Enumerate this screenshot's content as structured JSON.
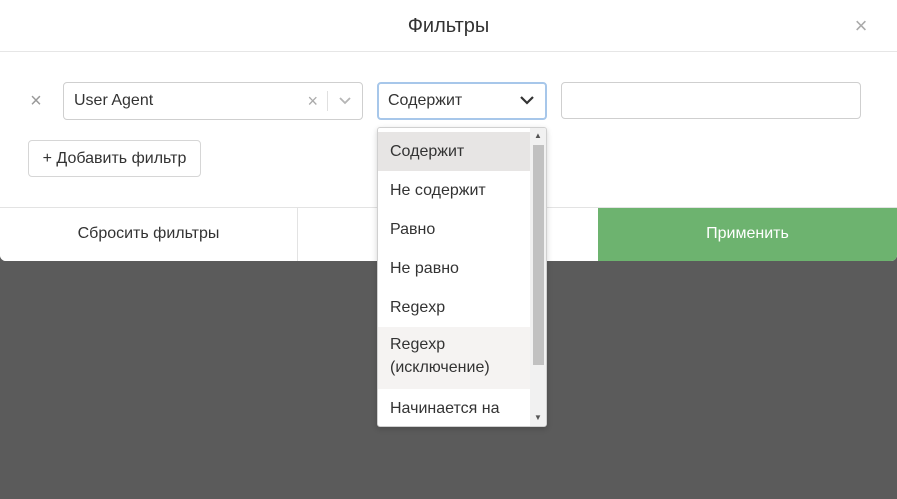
{
  "modal": {
    "title": "Фильтры",
    "close_glyph": "×"
  },
  "filter_row": {
    "remove_glyph": "×",
    "field": {
      "value": "User Agent",
      "clear_glyph": "×"
    },
    "operator": {
      "value": "Содержит",
      "expanded": true
    },
    "value_input": {
      "value": "",
      "placeholder": ""
    }
  },
  "add_filter_label": "+ Добавить фильтр",
  "footer": {
    "reset_label": "Сбросить фильтры",
    "apply_label": "Применить"
  },
  "dropdown": {
    "options": [
      {
        "label": "Содержит",
        "state": "selected"
      },
      {
        "label": "Не содержит",
        "state": ""
      },
      {
        "label": "Равно",
        "state": ""
      },
      {
        "label": "Не равно",
        "state": ""
      },
      {
        "label": "Regexp",
        "state": ""
      },
      {
        "label": "Regexp (исключение)",
        "line1": "Regexp",
        "line2": "(исключение)",
        "state": "hover"
      },
      {
        "label": "Начинается на",
        "state": ""
      }
    ],
    "scroll_up_glyph": "▲",
    "scroll_down_glyph": "▼"
  },
  "colors": {
    "accent_green": "#6db36f",
    "overlay": "#5b5b5b",
    "focus_border": "#a7c7ea",
    "selected_option": "#e7e5e4"
  },
  "icons": {
    "close": "close-icon",
    "chevron": "chevron-down-icon",
    "clear": "clear-icon"
  }
}
